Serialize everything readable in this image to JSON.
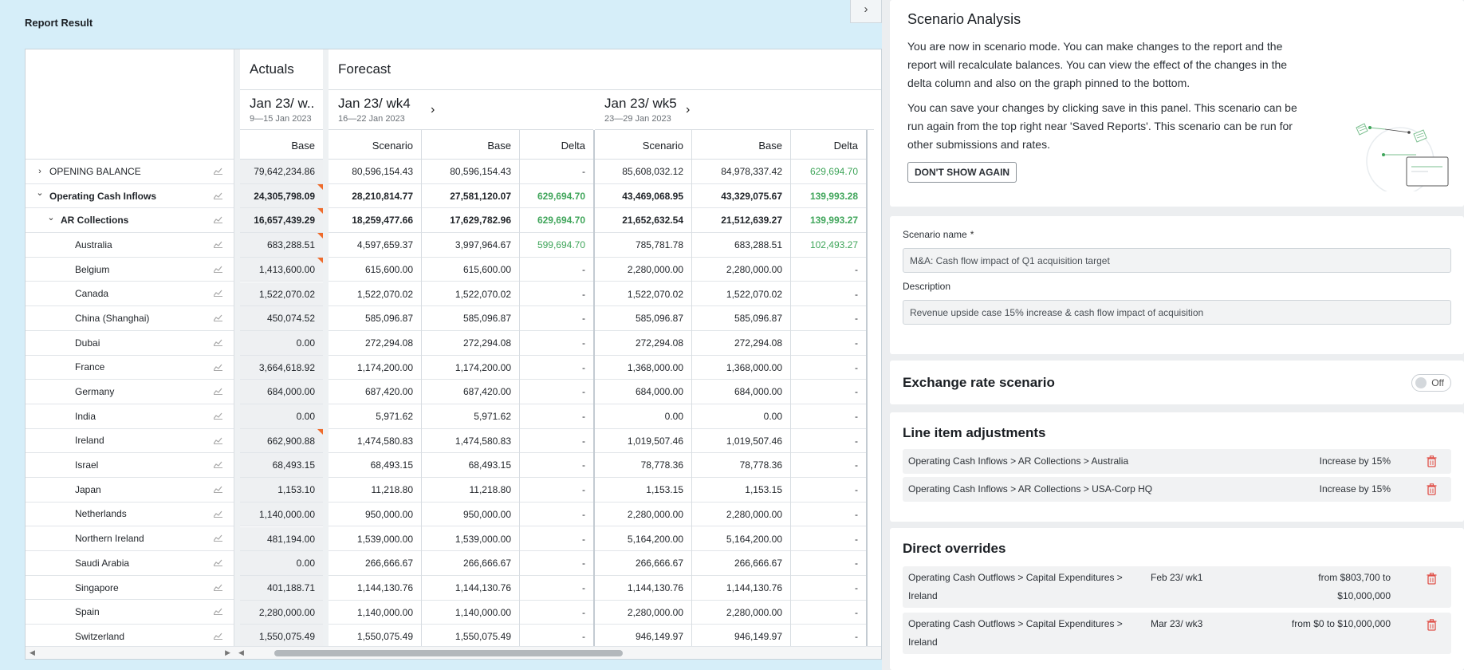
{
  "page_title": "Report Result",
  "report": {
    "groups": {
      "actuals": "Actuals",
      "forecast": "Forecast"
    },
    "weeks": [
      {
        "title": "Jan 23/ w...",
        "sub": "9—15 Jan 2023"
      },
      {
        "title": "Jan 23/ wk4",
        "sub": "16—22 Jan 2023"
      },
      {
        "title": "Jan 23/ wk5",
        "sub": "23—29 Jan 2023"
      }
    ],
    "col_labels": {
      "base": "Base",
      "scenario": "Scenario",
      "delta": "Delta"
    },
    "rows": [
      {
        "label": "OPENING BALANCE",
        "level": 0,
        "chev": "›",
        "bold": false,
        "flag": false,
        "cells": [
          "79,642,234.86",
          "80,596,154.43",
          "80,596,154.43",
          "-",
          "85,608,032.12",
          "84,978,337.42",
          "629,694.70"
        ],
        "green": [
          false,
          false,
          false,
          false,
          false,
          false,
          true
        ]
      },
      {
        "label": "Operating Cash Inflows",
        "level": 0,
        "chev": "⌄",
        "bold": true,
        "flag": true,
        "cells": [
          "24,305,798.09",
          "28,210,814.77",
          "27,581,120.07",
          "629,694.70",
          "43,469,068.95",
          "43,329,075.67",
          "139,993.28"
        ],
        "green": [
          false,
          false,
          false,
          true,
          false,
          false,
          true
        ]
      },
      {
        "label": "AR Collections",
        "level": 1,
        "chev": "⌄",
        "bold": true,
        "flag": true,
        "cells": [
          "16,657,439.29",
          "18,259,477.66",
          "17,629,782.96",
          "629,694.70",
          "21,652,632.54",
          "21,512,639.27",
          "139,993.27"
        ],
        "green": [
          false,
          false,
          false,
          true,
          false,
          false,
          true
        ]
      },
      {
        "label": "Australia",
        "level": 2,
        "chev": "",
        "bold": false,
        "flag": true,
        "cells": [
          "683,288.51",
          "4,597,659.37",
          "3,997,964.67",
          "599,694.70",
          "785,781.78",
          "683,288.51",
          "102,493.27"
        ],
        "green": [
          false,
          false,
          false,
          true,
          false,
          false,
          true
        ]
      },
      {
        "label": "Belgium",
        "level": 2,
        "chev": "",
        "bold": false,
        "flag": true,
        "cells": [
          "1,413,600.00",
          "615,600.00",
          "615,600.00",
          "-",
          "2,280,000.00",
          "2,280,000.00",
          "-"
        ],
        "green": [
          false,
          false,
          false,
          false,
          false,
          false,
          false
        ]
      },
      {
        "label": "Canada",
        "level": 2,
        "chev": "",
        "bold": false,
        "flag": false,
        "cells": [
          "1,522,070.02",
          "1,522,070.02",
          "1,522,070.02",
          "-",
          "1,522,070.02",
          "1,522,070.02",
          "-"
        ],
        "green": [
          false,
          false,
          false,
          false,
          false,
          false,
          false
        ]
      },
      {
        "label": "China (Shanghai)",
        "level": 2,
        "chev": "",
        "bold": false,
        "flag": false,
        "cells": [
          "450,074.52",
          "585,096.87",
          "585,096.87",
          "-",
          "585,096.87",
          "585,096.87",
          "-"
        ],
        "green": [
          false,
          false,
          false,
          false,
          false,
          false,
          false
        ]
      },
      {
        "label": "Dubai",
        "level": 2,
        "chev": "",
        "bold": false,
        "flag": false,
        "cells": [
          "0.00",
          "272,294.08",
          "272,294.08",
          "-",
          "272,294.08",
          "272,294.08",
          "-"
        ],
        "green": [
          false,
          false,
          false,
          false,
          false,
          false,
          false
        ]
      },
      {
        "label": "France",
        "level": 2,
        "chev": "",
        "bold": false,
        "flag": false,
        "cells": [
          "3,664,618.92",
          "1,174,200.00",
          "1,174,200.00",
          "-",
          "1,368,000.00",
          "1,368,000.00",
          "-"
        ],
        "green": [
          false,
          false,
          false,
          false,
          false,
          false,
          false
        ]
      },
      {
        "label": "Germany",
        "level": 2,
        "chev": "",
        "bold": false,
        "flag": false,
        "cells": [
          "684,000.00",
          "687,420.00",
          "687,420.00",
          "-",
          "684,000.00",
          "684,000.00",
          "-"
        ],
        "green": [
          false,
          false,
          false,
          false,
          false,
          false,
          false
        ]
      },
      {
        "label": "India",
        "level": 2,
        "chev": "",
        "bold": false,
        "flag": false,
        "cells": [
          "0.00",
          "5,971.62",
          "5,971.62",
          "-",
          "0.00",
          "0.00",
          "-"
        ],
        "green": [
          false,
          false,
          false,
          false,
          false,
          false,
          false
        ]
      },
      {
        "label": "Ireland",
        "level": 2,
        "chev": "",
        "bold": false,
        "flag": true,
        "cells": [
          "662,900.88",
          "1,474,580.83",
          "1,474,580.83",
          "-",
          "1,019,507.46",
          "1,019,507.46",
          "-"
        ],
        "green": [
          false,
          false,
          false,
          false,
          false,
          false,
          false
        ]
      },
      {
        "label": "Israel",
        "level": 2,
        "chev": "",
        "bold": false,
        "flag": false,
        "cells": [
          "68,493.15",
          "68,493.15",
          "68,493.15",
          "-",
          "78,778.36",
          "78,778.36",
          "-"
        ],
        "green": [
          false,
          false,
          false,
          false,
          false,
          false,
          false
        ]
      },
      {
        "label": "Japan",
        "level": 2,
        "chev": "",
        "bold": false,
        "flag": false,
        "cells": [
          "1,153.10",
          "11,218.80",
          "11,218.80",
          "-",
          "1,153.15",
          "1,153.15",
          "-"
        ],
        "green": [
          false,
          false,
          false,
          false,
          false,
          false,
          false
        ]
      },
      {
        "label": "Netherlands",
        "level": 2,
        "chev": "",
        "bold": false,
        "flag": false,
        "cells": [
          "1,140,000.00",
          "950,000.00",
          "950,000.00",
          "-",
          "2,280,000.00",
          "2,280,000.00",
          "-"
        ],
        "green": [
          false,
          false,
          false,
          false,
          false,
          false,
          false
        ]
      },
      {
        "label": "Northern Ireland",
        "level": 2,
        "chev": "",
        "bold": false,
        "flag": false,
        "cells": [
          "481,194.00",
          "1,539,000.00",
          "1,539,000.00",
          "-",
          "5,164,200.00",
          "5,164,200.00",
          "-"
        ],
        "green": [
          false,
          false,
          false,
          false,
          false,
          false,
          false
        ]
      },
      {
        "label": "Saudi Arabia",
        "level": 2,
        "chev": "",
        "bold": false,
        "flag": false,
        "cells": [
          "0.00",
          "266,666.67",
          "266,666.67",
          "-",
          "266,666.67",
          "266,666.67",
          "-"
        ],
        "green": [
          false,
          false,
          false,
          false,
          false,
          false,
          false
        ]
      },
      {
        "label": "Singapore",
        "level": 2,
        "chev": "",
        "bold": false,
        "flag": false,
        "cells": [
          "401,188.71",
          "1,144,130.76",
          "1,144,130.76",
          "-",
          "1,144,130.76",
          "1,144,130.76",
          "-"
        ],
        "green": [
          false,
          false,
          false,
          false,
          false,
          false,
          false
        ]
      },
      {
        "label": "Spain",
        "level": 2,
        "chev": "",
        "bold": false,
        "flag": false,
        "cells": [
          "2,280,000.00",
          "1,140,000.00",
          "1,140,000.00",
          "-",
          "2,280,000.00",
          "2,280,000.00",
          "-"
        ],
        "green": [
          false,
          false,
          false,
          false,
          false,
          false,
          false
        ]
      },
      {
        "label": "Switzerland",
        "level": 2,
        "chev": "",
        "bold": false,
        "flag": false,
        "cells": [
          "1,550,075.49",
          "1,550,075.49",
          "1,550,075.49",
          "-",
          "946,149.97",
          "946,149.97",
          "-"
        ],
        "green": [
          false,
          false,
          false,
          false,
          false,
          false,
          false
        ]
      }
    ]
  },
  "panel": {
    "title": "Scenario Analysis",
    "intro_p1": "You are now in scenario mode. You can make changes to the report and the report will recalculate balances. You can view the effect of the changes in the delta column and also on the graph pinned to the bottom.",
    "intro_p2": "You can save your changes by clicking save in this panel. This scenario can be run again from the top right near 'Saved Reports'. This scenario can be run for other submissions and rates.",
    "dont_show": "DON'T SHOW AGAIN",
    "scenario_name_label": "Scenario name",
    "required_mark": "*",
    "scenario_name_value": "M&A: Cash flow impact of Q1 acquisition target",
    "description_label": "Description",
    "description_value": "Revenue upside case 15% increase & cash flow impact of acquisition",
    "fx_title": "Exchange rate scenario",
    "fx_toggle": "Off",
    "li_title": "Line item adjustments",
    "line_items": [
      {
        "path": "Operating Cash Inflows > AR Collections > Australia",
        "value": "Increase by 15%"
      },
      {
        "path": "Operating Cash Inflows > AR Collections > USA-Corp HQ",
        "value": "Increase by 15%"
      }
    ],
    "ov_title": "Direct overrides",
    "overrides": [
      {
        "path": "Operating Cash Outflows > Capital Expenditures > Ireland",
        "week": "Feb 23/ wk1",
        "value": "from $803,700 to $10,000,000"
      },
      {
        "path": "Operating Cash Outflows > Capital Expenditures > Ireland",
        "week": "Mar 23/ wk3",
        "value": "from $0 to $10,000,000"
      }
    ]
  },
  "colors": {
    "background": "#d6eef9",
    "delta_green": "#3fa55a",
    "flag_orange": "#ef6b2b",
    "trash_red": "#e0524a"
  },
  "icons": [
    "chevron-right-icon",
    "chevron-down-icon",
    "graph-icon",
    "trash-icon",
    "collapse-panel-icon"
  ]
}
